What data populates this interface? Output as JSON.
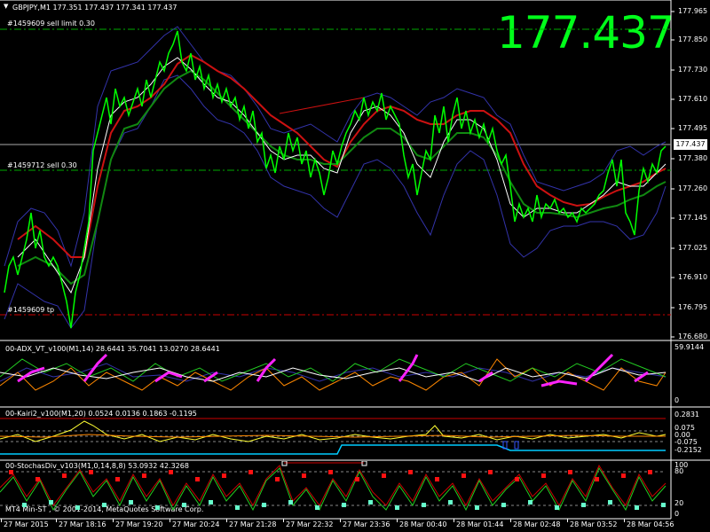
{
  "symbol_header": "GBPJPY,M1  177.351 177.437 177.341 177.437",
  "big_price": "177.437",
  "current_price_tag": "177.437",
  "orders": {
    "sell_limit": "#1459609 sell limit 0.30",
    "sell": "#1459712 sell 0.30",
    "tp": "#1459609 tp"
  },
  "price_axis": [
    "177.965",
    "177.850",
    "177.730",
    "177.610",
    "177.495",
    "177.380",
    "177.260",
    "177.145",
    "177.025",
    "176.910",
    "176.795",
    "176.680"
  ],
  "indicators": {
    "adx": {
      "label": "00-ADX_VT_v100(M1,14) 28.6441 35.7041 13.0270 28.6441",
      "axis_top": "59.9144",
      "axis_bottom": "0"
    },
    "kairi": {
      "label": "00-Kairi2_v100(M1,20) 0.0524 0.0136 0.1863 -0.1195",
      "axis": [
        "0.2831",
        "0.075",
        "0.00",
        "-0.075",
        "-0.2152"
      ]
    },
    "stochas": {
      "label": "00-StochasDiv_v103(M1,0,14,8,8) 53.0932 42.3268",
      "axis": [
        "100",
        "80",
        "20",
        "0"
      ]
    }
  },
  "copyright": "MT4 Min-ST , © 2001-2014, MetaQuotes Software Corp.",
  "time_axis": [
    "27 Mar 2015",
    "27 Mar 18:16",
    "27 Mar 19:20",
    "27 Mar 20:24",
    "27 Mar 21:28",
    "27 Mar 22:32",
    "27 Mar 23:36",
    "28 Mar 00:40",
    "28 Mar 01:44",
    "28 Mar 02:48",
    "28 Mar 03:52",
    "28 Mar 04:56"
  ],
  "colors": {
    "price_line": "#00ff00",
    "ma_red": "#cc1111",
    "ma_green": "#118811",
    "ma_white": "#ffffff",
    "band": "#3333aa",
    "grid": "#ffffff"
  }
}
